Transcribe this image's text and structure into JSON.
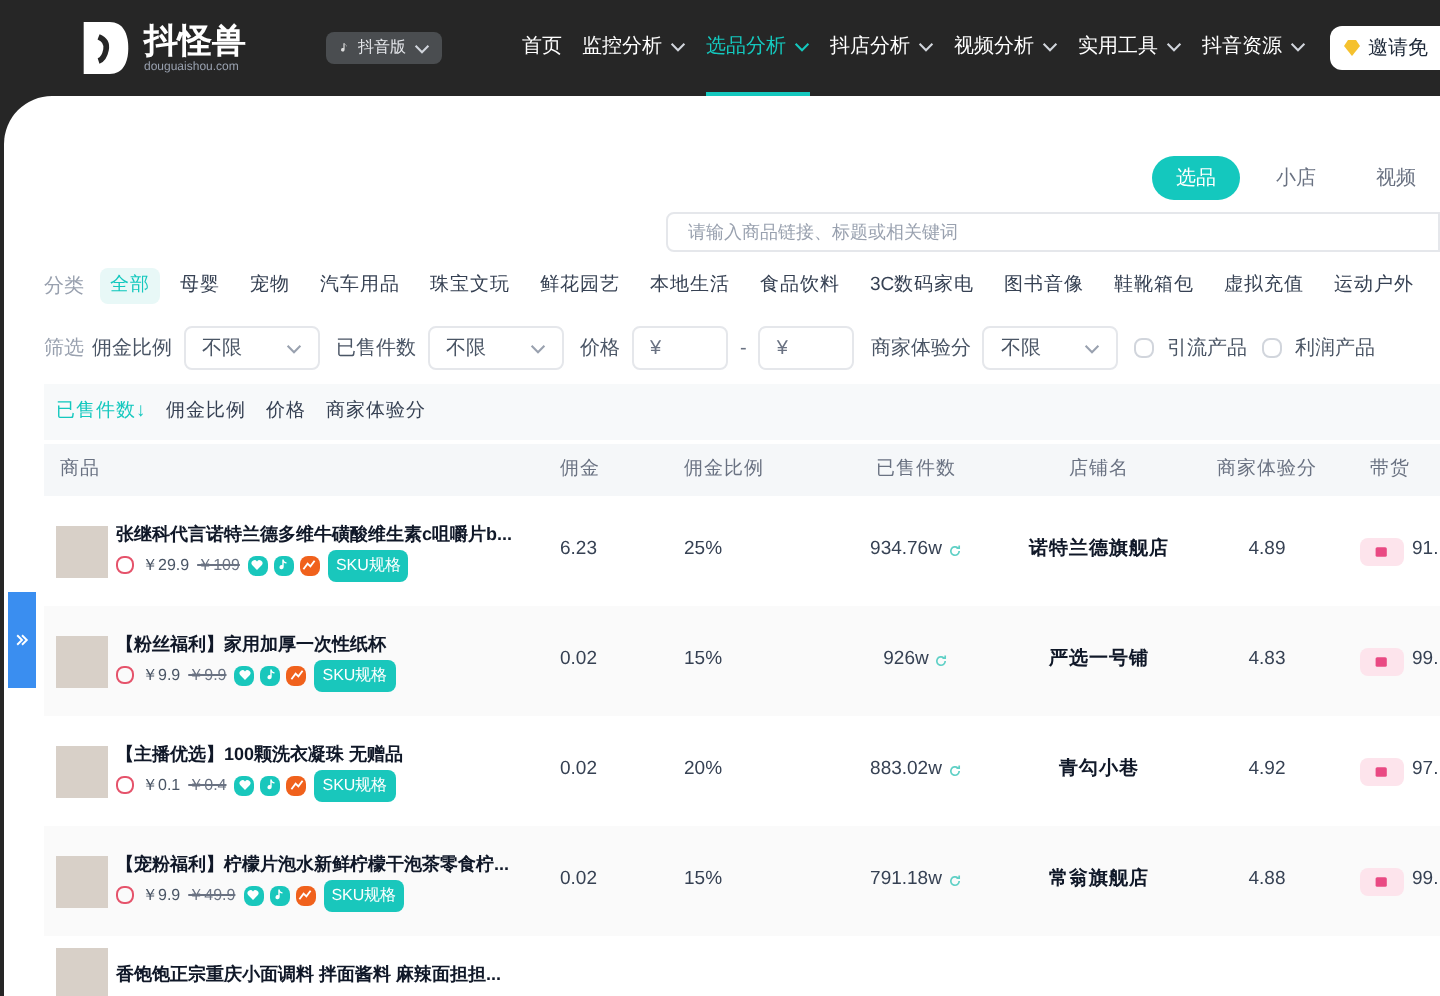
{
  "header": {
    "logo_text": "抖怪兽",
    "logo_domain": "douguaishou.com",
    "version": "抖音版",
    "nav": [
      {
        "label": "首页",
        "dropdown": false,
        "selected": false
      },
      {
        "label": "监控分析",
        "dropdown": true,
        "selected": false
      },
      {
        "label": "选品分析",
        "dropdown": true,
        "selected": true
      },
      {
        "label": "抖店分析",
        "dropdown": true,
        "selected": false
      },
      {
        "label": "视频分析",
        "dropdown": true,
        "selected": false
      },
      {
        "label": "实用工具",
        "dropdown": true,
        "selected": false
      },
      {
        "label": "抖音资源",
        "dropdown": true,
        "selected": false
      }
    ],
    "invite_button": "邀请免"
  },
  "mode_tabs": [
    {
      "label": "选品",
      "selected": true
    },
    {
      "label": "小店",
      "selected": false
    },
    {
      "label": "视频",
      "selected": false
    }
  ],
  "search": {
    "placeholder": "请输入商品链接、标题或相关键词"
  },
  "categories": {
    "label": "分类",
    "items": [
      {
        "label": "全部",
        "selected": true
      },
      {
        "label": "母婴",
        "selected": false
      },
      {
        "label": "宠物",
        "selected": false
      },
      {
        "label": "汽车用品",
        "selected": false
      },
      {
        "label": "珠宝文玩",
        "selected": false
      },
      {
        "label": "鲜花园艺",
        "selected": false
      },
      {
        "label": "本地生活",
        "selected": false
      },
      {
        "label": "食品饮料",
        "selected": false
      },
      {
        "label": "3C数码家电",
        "selected": false
      },
      {
        "label": "图书音像",
        "selected": false
      },
      {
        "label": "鞋靴箱包",
        "selected": false
      },
      {
        "label": "虚拟充值",
        "selected": false
      },
      {
        "label": "运动户外",
        "selected": false
      }
    ]
  },
  "filters": {
    "label": "筛选",
    "items": [
      {
        "kind": "select",
        "label": "佣金比例",
        "value": "不限"
      },
      {
        "kind": "select",
        "label": "已售件数",
        "value": "不限"
      },
      {
        "kind": "range",
        "label": "价格",
        "min_placeholder": "¥",
        "separator": "-",
        "max_placeholder": "¥"
      },
      {
        "kind": "select",
        "label": "商家体验分",
        "value": "不限"
      },
      {
        "kind": "checkbox",
        "label": "引流产品",
        "checked": false
      },
      {
        "kind": "checkbox",
        "label": "利润产品",
        "checked": false
      }
    ]
  },
  "sort": [
    {
      "label": "已售件数↓",
      "selected": true
    },
    {
      "label": "佣金比例",
      "selected": false
    },
    {
      "label": "价格",
      "selected": false
    },
    {
      "label": "商家体验分",
      "selected": false
    }
  ],
  "table": {
    "columns": [
      "商品",
      "佣金",
      "佣金比例",
      "已售件数",
      "店铺名",
      "商家体验分",
      "带货"
    ],
    "rows": [
      {
        "title": "张继科代言诺特兰德多维牛磺酸维生素c咀嚼片b...",
        "price": "￥29.9",
        "original_price": "￥109",
        "sku": "SKU规格",
        "commission": "6.23",
        "rate": "25%",
        "sold": "934.76w",
        "shop": "诺特兰德旗舰店",
        "score": "4.89",
        "last": "91."
      },
      {
        "title": "【粉丝福利】家用加厚一次性纸杯",
        "price": "￥9.9",
        "original_price": "￥9.9",
        "sku": "SKU规格",
        "commission": "0.02",
        "rate": "15%",
        "sold": "926w",
        "shop": "严选一号铺",
        "score": "4.83",
        "last": "99."
      },
      {
        "title": "【主播优选】100颗洗衣凝珠 无赠品",
        "price": "￥0.1",
        "original_price": "￥0.4",
        "sku": "SKU规格",
        "commission": "0.02",
        "rate": "20%",
        "sold": "883.02w",
        "shop": "青勾小巷",
        "score": "4.92",
        "last": "97."
      },
      {
        "title": "【宠粉福利】柠檬片泡水新鲜柠檬干泡茶零食柠...",
        "price": "￥9.9",
        "original_price": "￥49.9",
        "sku": "SKU规格",
        "commission": "0.02",
        "rate": "15%",
        "sold": "791.18w",
        "shop": "常翁旗舰店",
        "score": "4.88",
        "last": "99."
      },
      {
        "title": "香饱饱正宗重庆小面调料 拌面酱料 麻辣面担担..."
      }
    ]
  }
}
